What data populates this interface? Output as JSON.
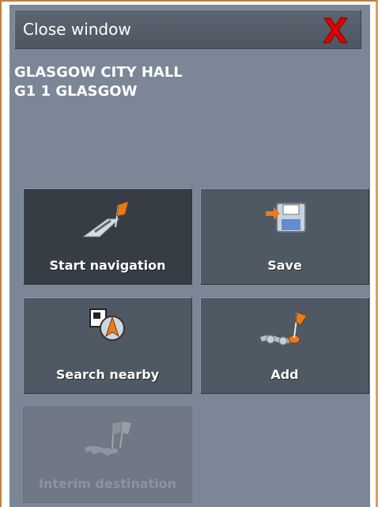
{
  "window": {
    "title": "Close window",
    "close_icon": "close-icon-red-x"
  },
  "location": {
    "line1": "GLASGOW CITY HALL",
    "line2": "G1 1 GLASGOW"
  },
  "buttons": {
    "start_navigation": {
      "label": "Start navigation",
      "icon": "route-flag-icon"
    },
    "save": {
      "label": "Save",
      "icon": "save-disk-icon"
    },
    "search_nearby": {
      "label": "Search nearby",
      "icon": "fuel-poi-icon"
    },
    "add": {
      "label": "Add",
      "icon": "add-waypoint-flag-icon"
    },
    "interim_destination": {
      "label": "Interim destination",
      "icon": "checkered-flags-icon",
      "enabled": false
    }
  },
  "colors": {
    "panel": "#7b8797",
    "button": "#4f5964",
    "accent_orange": "#e87a20",
    "close_red": "#e00000"
  }
}
